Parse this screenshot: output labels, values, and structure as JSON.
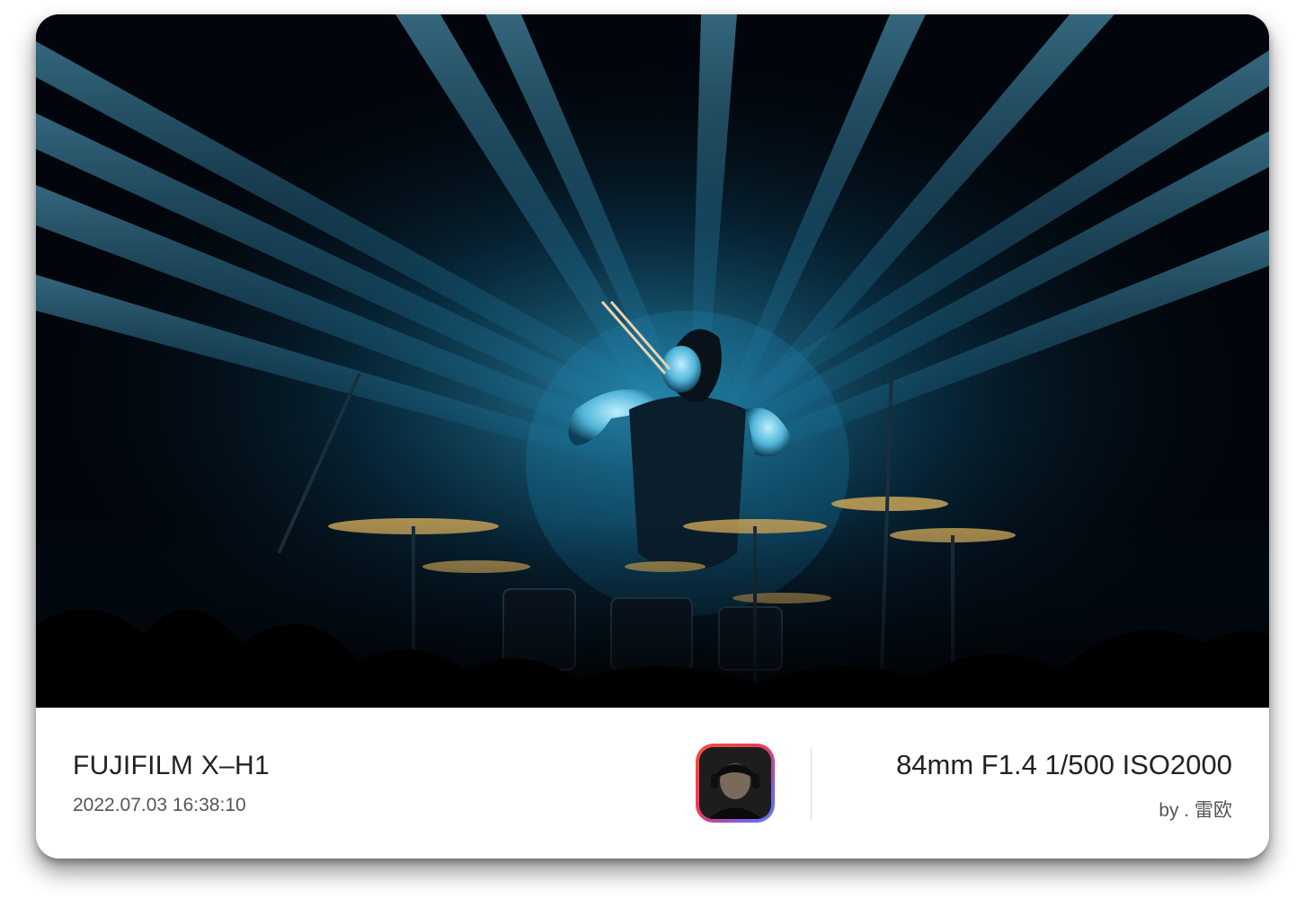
{
  "photo": {
    "subject": "drummer-on-stage-photo"
  },
  "info": {
    "camera_model": "FUJIFILM X–H1",
    "datetime": "2022.07.03 16:38:10",
    "exif": "84mm F1.4 1/500 ISO2000",
    "byline": "by . 雷欧"
  },
  "colors": {
    "beam": "#2fb6e6",
    "stage_dark": "#02060c",
    "avatar_gradient_start": "#f0523c",
    "avatar_gradient_end": "#5a7ff2"
  }
}
